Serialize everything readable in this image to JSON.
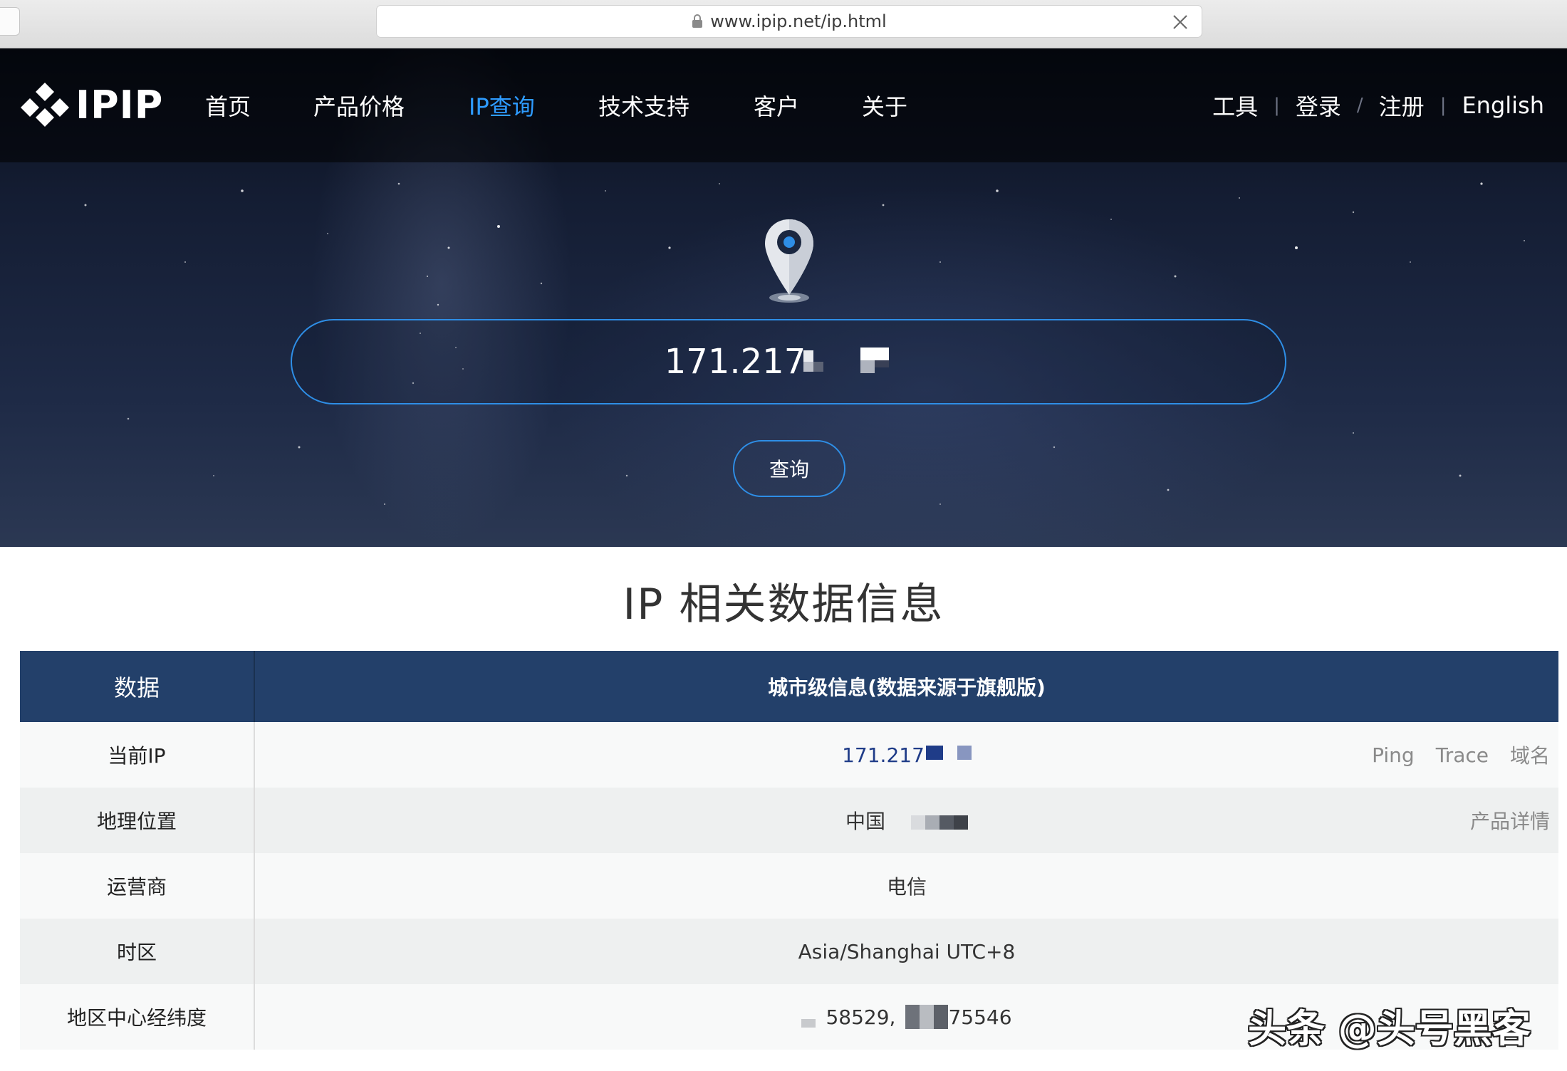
{
  "browser": {
    "url": "www.ipip.net/ip.html"
  },
  "nav": {
    "logo_text": "IPIP",
    "items": [
      {
        "label": "首页",
        "active": false
      },
      {
        "label": "产品价格",
        "active": false
      },
      {
        "label": "IP查询",
        "active": true
      },
      {
        "label": "技术支持",
        "active": false
      },
      {
        "label": "客户",
        "active": false
      },
      {
        "label": "关于",
        "active": false
      }
    ],
    "right": {
      "tools": "工具",
      "login": "登录",
      "register": "注册",
      "english": "English"
    }
  },
  "search": {
    "value": "171.217",
    "button": "查询"
  },
  "section": {
    "title": "IP 相关数据信息"
  },
  "table": {
    "header": {
      "col1": "数据",
      "col2": "城市级信息(数据来源于旗舰版)"
    },
    "rows": [
      {
        "label": "当前IP",
        "value": "171.217",
        "actions": [
          "Ping",
          "Trace",
          "域名"
        ]
      },
      {
        "label": "地理位置",
        "value": "中国",
        "actions": [
          "产品详情"
        ]
      },
      {
        "label": "运营商",
        "value": "电信"
      },
      {
        "label": "时区",
        "value": "Asia/Shanghai UTC+8"
      },
      {
        "label": "地区中心经纬度",
        "value_a": "58529,",
        "value_b": "75546"
      }
    ]
  },
  "watermark": "头条 @头号黑客",
  "colors": {
    "accent": "#2e9bff",
    "table_header": "#23406a",
    "ip_link": "#1f3c88"
  }
}
